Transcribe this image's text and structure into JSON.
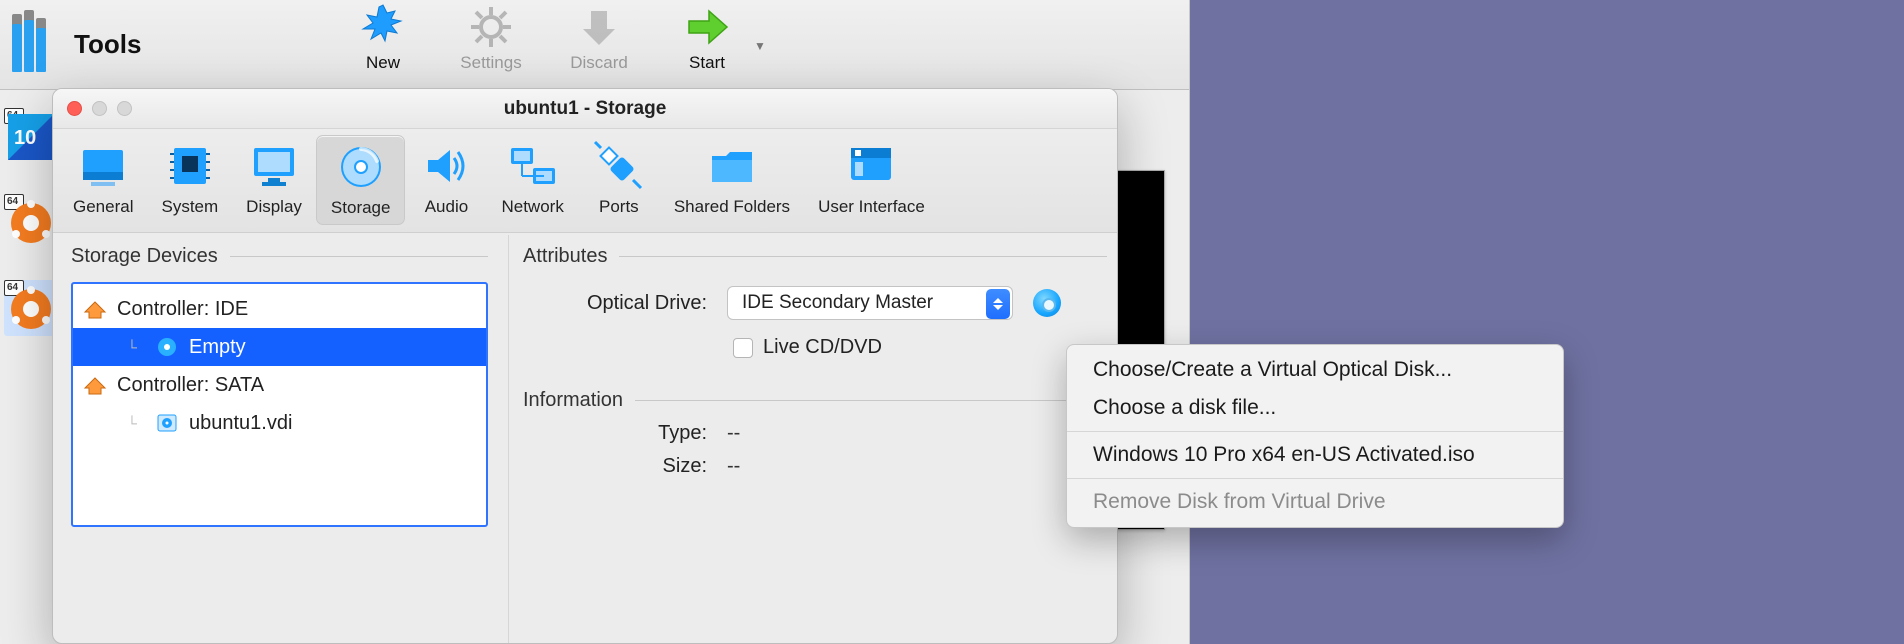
{
  "main": {
    "tools_label": "Tools",
    "toolbar": [
      {
        "id": "new",
        "label": "New",
        "state": "active"
      },
      {
        "id": "settings",
        "label": "Settings",
        "state": "disabled"
      },
      {
        "id": "discard",
        "label": "Discard",
        "state": "disabled"
      },
      {
        "id": "start",
        "label": "Start",
        "state": "active"
      }
    ],
    "vm_badge": "64"
  },
  "dialog": {
    "title": "ubuntu1 - Storage",
    "tabs": [
      "General",
      "System",
      "Display",
      "Storage",
      "Audio",
      "Network",
      "Ports",
      "Shared Folders",
      "User Interface"
    ],
    "selected_tab": "Storage",
    "storage": {
      "section_label": "Storage Devices",
      "tree": [
        {
          "kind": "controller",
          "label": "Controller: IDE"
        },
        {
          "kind": "leaf",
          "label": "Empty",
          "selected": true,
          "icon": "optical"
        },
        {
          "kind": "controller",
          "label": "Controller: SATA"
        },
        {
          "kind": "leaf",
          "label": "ubuntu1.vdi",
          "icon": "hdd"
        }
      ]
    },
    "attributes": {
      "section_label": "Attributes",
      "optical_label": "Optical Drive:",
      "optical_value": "IDE Secondary Master",
      "live_label": "Live CD/DVD",
      "live_checked": false
    },
    "information": {
      "section_label": "Information",
      "rows": [
        {
          "label": "Type:",
          "value": "--"
        },
        {
          "label": "Size:",
          "value": "--"
        }
      ]
    }
  },
  "menu": {
    "items": [
      {
        "label": "Choose/Create a Virtual Optical Disk...",
        "enabled": true
      },
      {
        "label": "Choose a disk file...",
        "enabled": true
      },
      {
        "sep": true
      },
      {
        "label": "Windows 10 Pro x64 en-US Activated.iso",
        "enabled": true
      },
      {
        "sep": true
      },
      {
        "label": "Remove Disk from Virtual Drive",
        "enabled": false
      }
    ]
  }
}
